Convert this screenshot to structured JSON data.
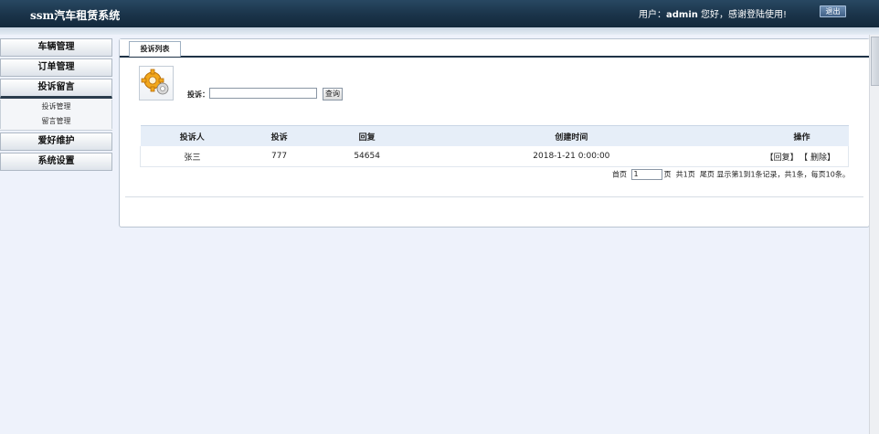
{
  "header": {
    "title": "ssm汽车租赁系统",
    "user_prefix": "用户：",
    "username": "admin",
    "greeting": " 您好，感谢登陆使用!",
    "logout_label": "退出"
  },
  "sidebar": {
    "items": [
      {
        "label": "车辆管理"
      },
      {
        "label": "订单管理"
      },
      {
        "label": "投诉留言",
        "active": true
      },
      {
        "label": "爱好维护"
      },
      {
        "label": "系统设置"
      }
    ],
    "sub_items": [
      "投诉管理",
      "留言管理"
    ]
  },
  "tab": {
    "label": "投诉列表"
  },
  "search": {
    "label": "投诉：",
    "value": "",
    "button_label": "查询"
  },
  "table": {
    "headers": [
      "投诉人",
      "投诉",
      "回复",
      "创建时间",
      "操作"
    ],
    "rows": [
      {
        "complainant": "张三",
        "complaint": "777",
        "reply": "54654",
        "created": "2018-1-21 0:00:00",
        "reply_link": "【回复】",
        "delete_link": "【 删除】"
      }
    ]
  },
  "pager": {
    "first": "首页",
    "page_value": "1",
    "page_suffix": "页",
    "total_pages": "共1页",
    "last": "尾页",
    "summary": "显示第1到1条记录，共1条，每页10条。"
  },
  "colors": {
    "header_bg": "#1a3349",
    "table_header_bg": "#e6eef8",
    "page_bg": "#eef2fb"
  }
}
